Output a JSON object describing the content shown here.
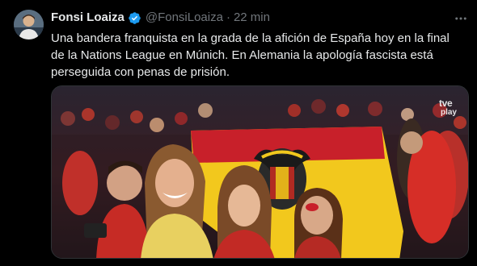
{
  "tweet": {
    "author_name": "Fonsi Loaiza",
    "handle": "@FonsiLoaiza",
    "separator": "·",
    "time": "22 min",
    "verified_icon": "verified-badge-icon",
    "more_icon": "more-options-icon",
    "text_lines": [
      "Una bandera franquista en la grada de la afición de España hoy en la final",
      "de la Nations League en Múnich. En Alemania la apología fascista está",
      "perseguida con penas de prisión."
    ]
  },
  "media": {
    "watermark_line1": "tve",
    "watermark_line2": "play"
  },
  "colors": {
    "background": "#000000",
    "text": "#e7e9ea",
    "secondary": "#71767b",
    "verified": "#1d9bf0",
    "flag_red": "#c8202a",
    "flag_yellow": "#f2c81d"
  }
}
